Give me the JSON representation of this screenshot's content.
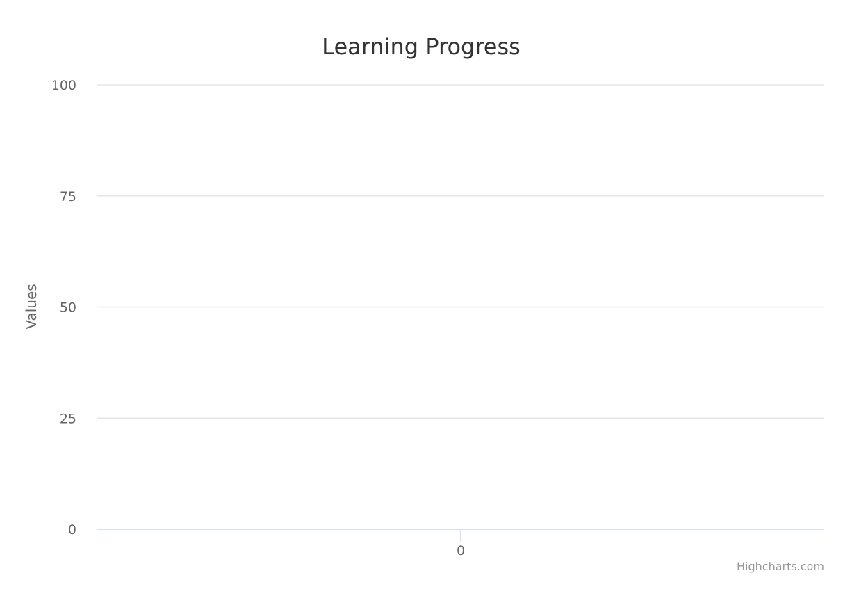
{
  "chart_data": {
    "type": "line",
    "title": "Learning Progress",
    "xlabel": "",
    "ylabel": "Values",
    "categories": [
      "0"
    ],
    "x_ticks": [
      "0"
    ],
    "y_ticks": [
      0,
      25,
      50,
      75,
      100
    ],
    "ylim": [
      0,
      100
    ],
    "grid": true,
    "series": []
  },
  "credits": "Highcharts.com",
  "colors": {
    "title": "#333333",
    "axis_text": "#666666",
    "grid": "#e6e6e6",
    "axis_line": "#ccd6eb",
    "credits": "#999999"
  }
}
